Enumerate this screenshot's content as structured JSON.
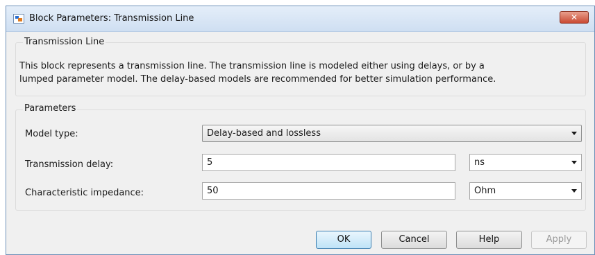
{
  "window": {
    "title": "Block Parameters: Transmission Line",
    "close_symbol": "✕"
  },
  "block": {
    "group_label": "Transmission Line",
    "description_line1": "This block represents a transmission line. The transmission line is modeled either using delays, or by a",
    "description_line2": "lumped parameter model. The delay-based models are recommended for better simulation performance."
  },
  "parameters": {
    "group_label": "Parameters",
    "model_type": {
      "label": "Model type:",
      "value": "Delay-based and lossless"
    },
    "transmission_delay": {
      "label": "Transmission delay:",
      "value": "5",
      "unit": "ns"
    },
    "characteristic_impedance": {
      "label": "Characteristic impedance:",
      "value": "50",
      "unit": "Ohm"
    }
  },
  "buttons": {
    "ok": "OK",
    "cancel": "Cancel",
    "help": "Help",
    "apply": "Apply"
  },
  "icons": {
    "app": "simulink-block-icon",
    "close": "close-icon",
    "dropdown": "chevron-down-icon"
  }
}
